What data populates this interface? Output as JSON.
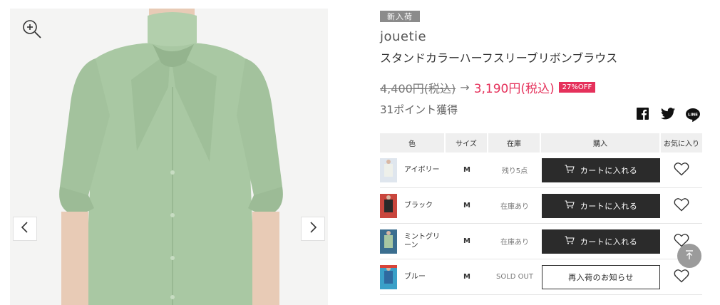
{
  "gallery": {
    "prev_icon": "chevron-left-icon",
    "next_icon": "chevron-right-icon",
    "zoom_icon": "zoom-in-icon"
  },
  "product": {
    "badge": "新入荷",
    "brand": "jouetie",
    "name": "スタンドカラーハーフスリーブリボンブラウス",
    "price_original": "4,400円(税込)",
    "arrow": "→",
    "price_sale": "3,190円(税込)",
    "discount": "27%OFF",
    "points": "31ポイント獲得"
  },
  "share": [
    "facebook-icon",
    "twitter-icon",
    "line-icon"
  ],
  "table": {
    "headers": {
      "color": "色",
      "size": "サイズ",
      "stock": "在庫",
      "buy": "購入",
      "fav": "お気に入り"
    },
    "rows": [
      {
        "color": "アイボリー",
        "size": "M",
        "stock": "残り5点",
        "action": "カートに入れる",
        "type": "cart",
        "swatch": "#e9ece6"
      },
      {
        "color": "ブラック",
        "size": "M",
        "stock": "在庫あり",
        "action": "カートに入れる",
        "type": "cart",
        "swatch": "#2a2a2a"
      },
      {
        "color": "ミントグリーン",
        "size": "M",
        "stock": "在庫あり",
        "action": "カートに入れる",
        "type": "cart",
        "swatch": "#a8c7a2"
      },
      {
        "color": "ブルー",
        "size": "M",
        "stock": "SOLD OUT",
        "action": "再入荷のお知らせ",
        "type": "notify",
        "swatch": "#5f8fb8"
      }
    ]
  },
  "colors": {
    "accent": "#e5315b",
    "button_dark": "#2b2b2b",
    "blouse": "#a9c8a3"
  }
}
